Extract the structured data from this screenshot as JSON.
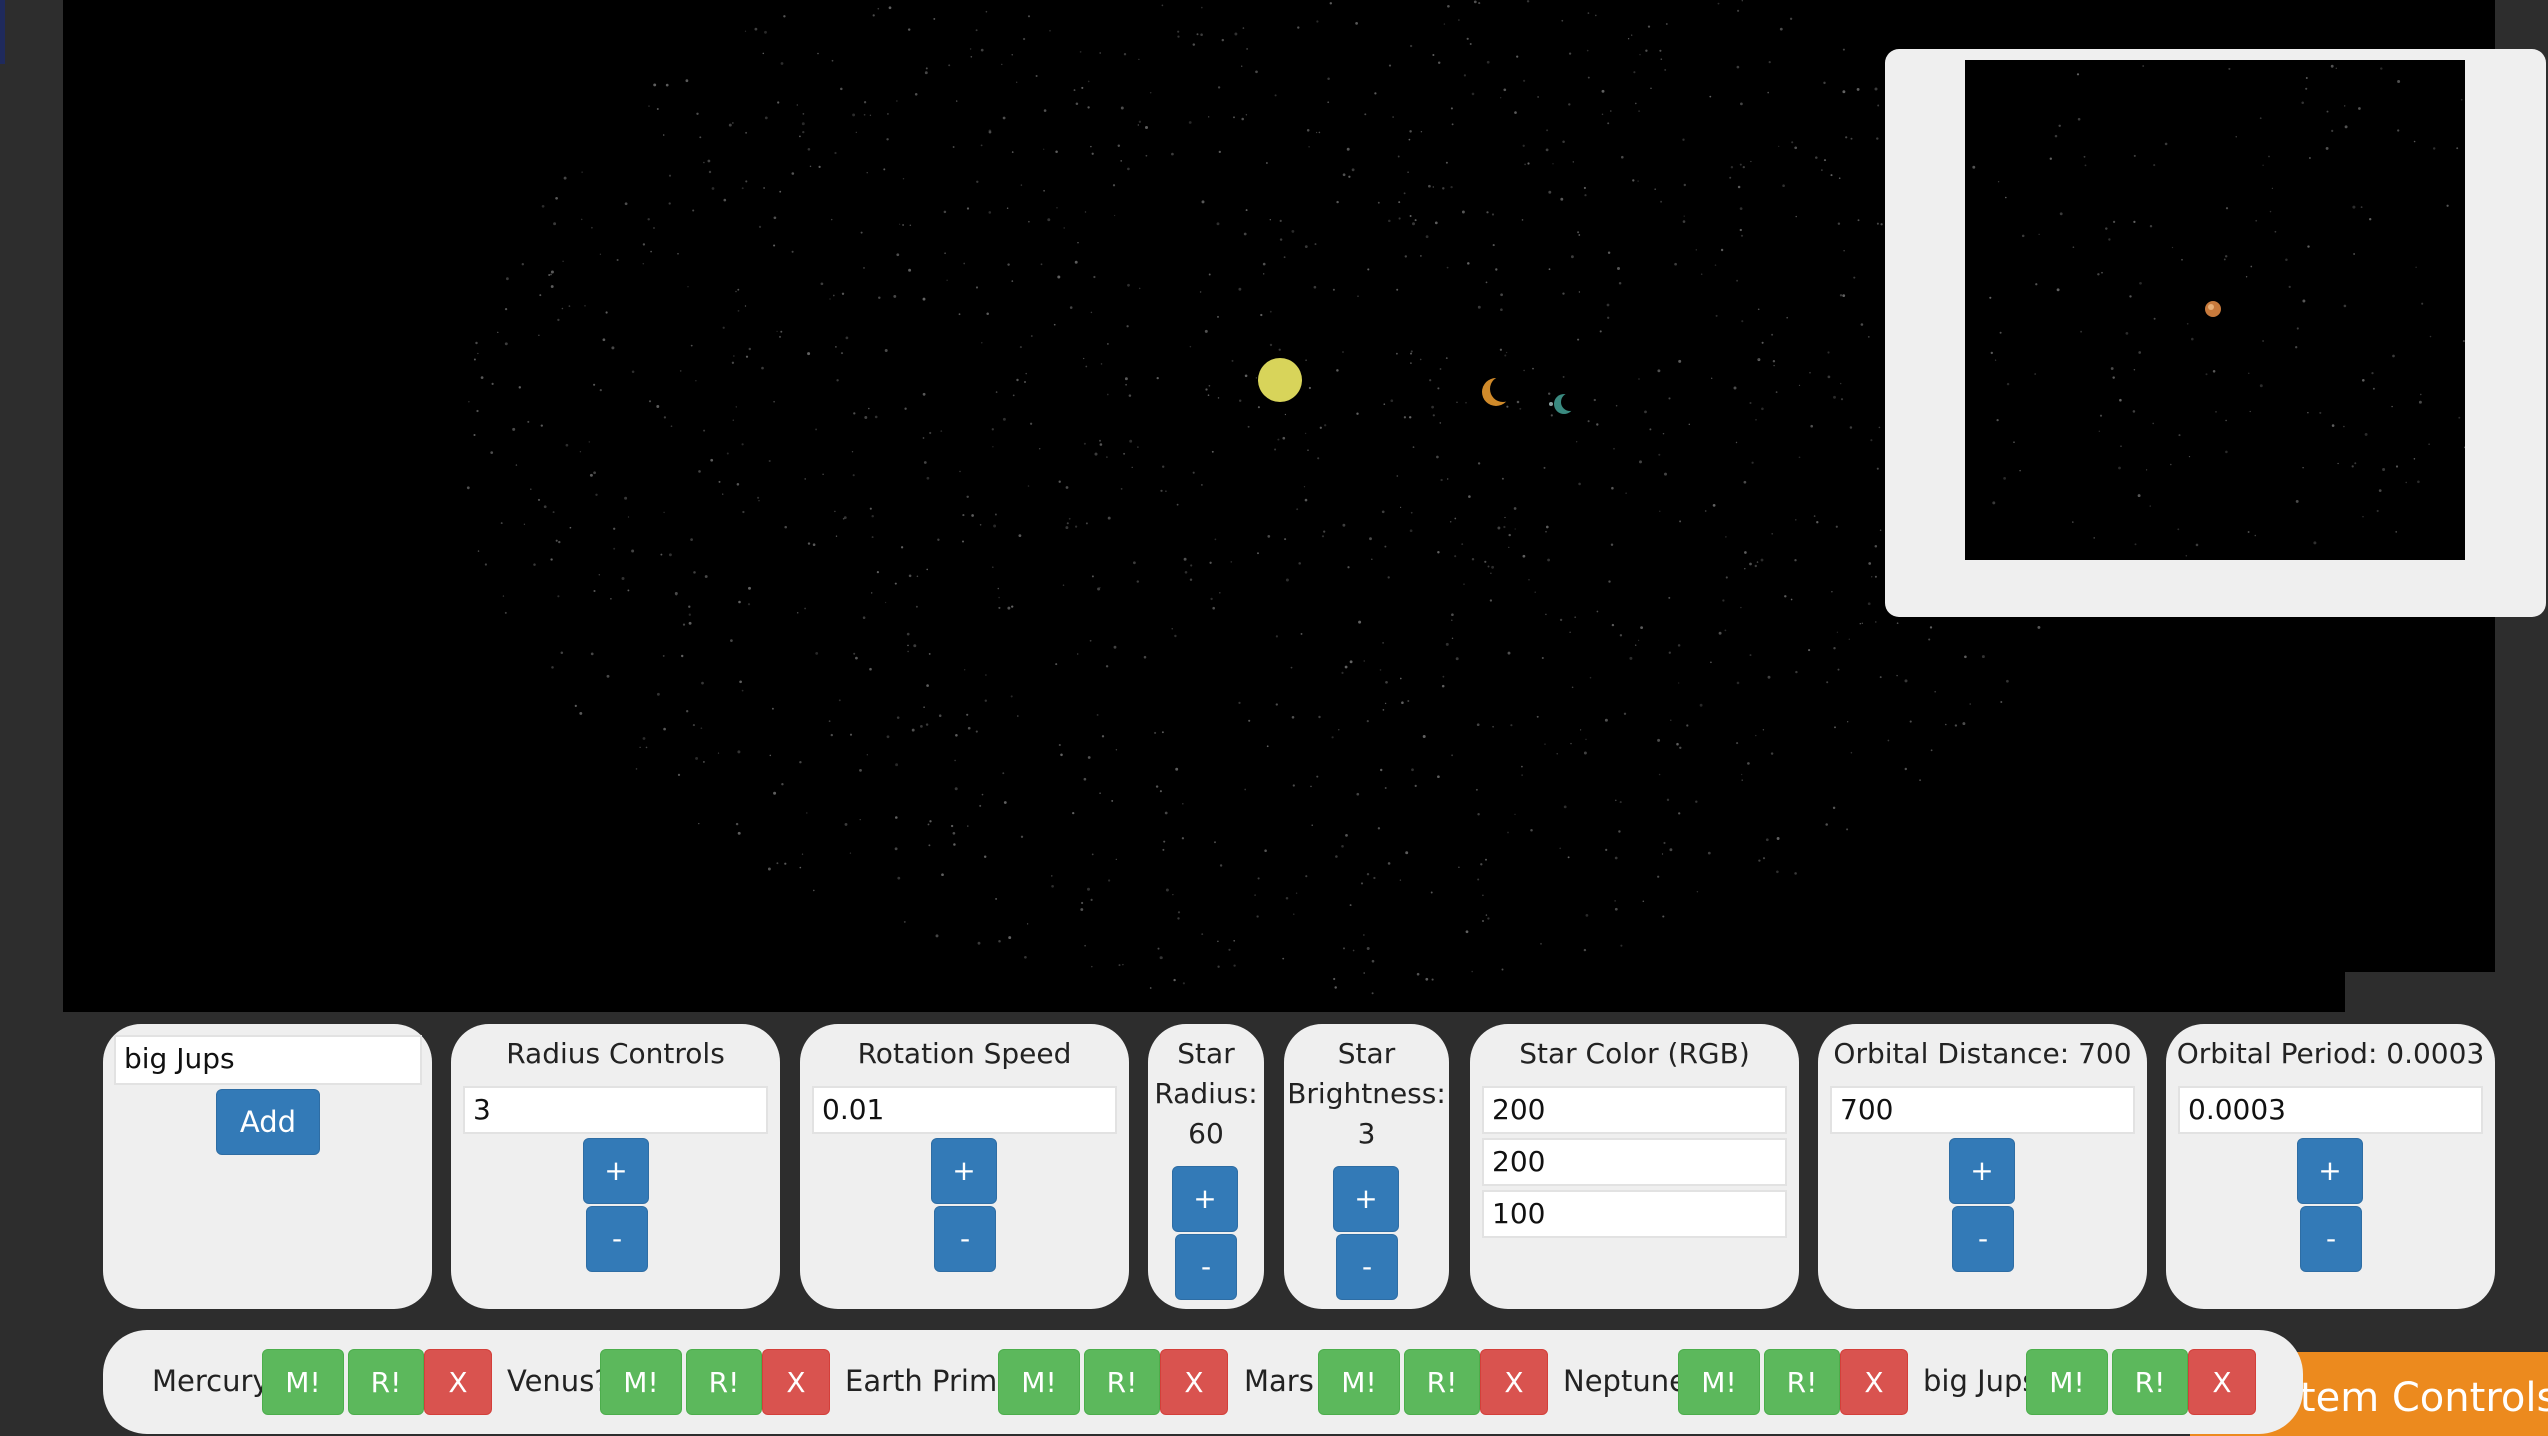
{
  "add_planet": {
    "name_value": "big Jups",
    "add_label": "Add"
  },
  "radius_controls": {
    "title": "Radius Controls",
    "value": "3",
    "plus_label": "+",
    "minus_label": "-"
  },
  "rotation_speed": {
    "title": "Rotation Speed",
    "value": "0.01",
    "plus_label": "+",
    "minus_label": "-"
  },
  "star_radius": {
    "title_line1": "Star",
    "title_line2": "Radius:",
    "value": "60",
    "plus_label": "+",
    "minus_label": "-"
  },
  "star_brightness": {
    "title_line1": "Star",
    "title_line2": "Brightness:",
    "value": "3",
    "plus_label": "+",
    "minus_label": "-"
  },
  "star_color": {
    "title": "Star Color (RGB)",
    "r": "200",
    "g": "200",
    "b": "100"
  },
  "orbital_distance": {
    "title": "Orbital Distance: 700",
    "value": "700",
    "plus_label": "+",
    "minus_label": "-"
  },
  "orbital_period": {
    "title": "Orbital Period: 0.0003",
    "value": "0.0003",
    "plus_label": "+",
    "minus_label": "-"
  },
  "planets": [
    {
      "name": "Mercury",
      "move_label": "M!",
      "rotate_label": "R!",
      "remove_label": "X"
    },
    {
      "name": "Venus?",
      "move_label": "M!",
      "rotate_label": "R!",
      "remove_label": "X"
    },
    {
      "name": "Earth Prime",
      "move_label": "M!",
      "rotate_label": "R!",
      "remove_label": "X"
    },
    {
      "name": "Mars!",
      "move_label": "M!",
      "rotate_label": "R!",
      "remove_label": "X"
    },
    {
      "name": "Neptune",
      "move_label": "M!",
      "rotate_label": "R!",
      "remove_label": "X"
    },
    {
      "name": "big Jups",
      "move_label": "M!",
      "rotate_label": "R!",
      "remove_label": "X"
    }
  ],
  "system_controls_label": "System Controls",
  "colors": {
    "background": "#2d2d2d",
    "space": "#000000",
    "panel": "#efefef",
    "primary_button": "#337ab7",
    "success_button": "#5cb85c",
    "danger_button": "#d9534f",
    "tab_orange": "#ec8a1e",
    "sun": "#d8d45a",
    "planet_orange": "#d08a2a",
    "planet_teal": "#3a8a80",
    "minimap_planet": "#c87a3c"
  }
}
